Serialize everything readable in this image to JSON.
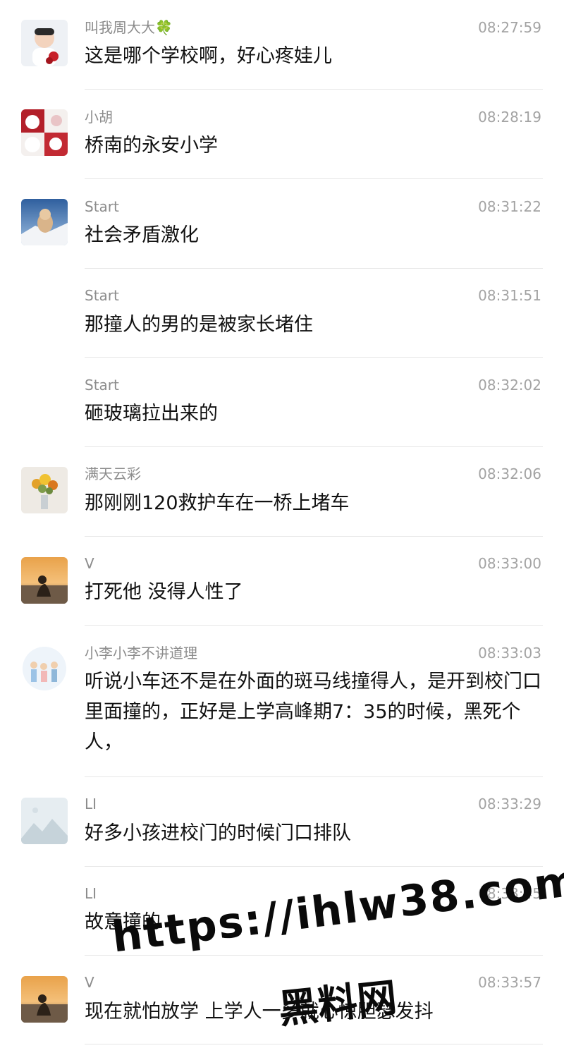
{
  "messages": [
    {
      "name": "叫我周大大🍀",
      "time": "08:27:59",
      "text": "这是哪个学校啊，好心疼娃儿",
      "avatar": "boy-photo-avatar"
    },
    {
      "name": "小胡",
      "time": "08:28:19",
      "text": "桥南的永安小学",
      "avatar": "pig-collage-avatar"
    },
    {
      "name": "Start",
      "time": "08:31:22",
      "text": "社会矛盾激化",
      "avatar": "dog-in-snow-avatar"
    },
    {
      "name": "Start",
      "time": "08:31:51",
      "text": "那撞人的男的是被家长堵住",
      "avatar": ""
    },
    {
      "name": "Start",
      "time": "08:32:02",
      "text": "砸玻璃拉出来的",
      "avatar": ""
    },
    {
      "name": "满天云彩",
      "time": "08:32:06",
      "text": "那刚刚120救护车在一桥上堵车",
      "avatar": "flower-bouquet-avatar"
    },
    {
      "name": "V",
      "time": "08:33:00",
      "text": "打死他 没得人性了",
      "avatar": "sunset-silhouette-avatar"
    },
    {
      "name": "小李小李不讲道理",
      "time": "08:33:03",
      "text": "听说小车还不是在外面的斑马线撞得人，是开到校门口里面撞的，正好是上学高峰期7：35的时候，黑死个人，",
      "avatar": "family-illustration-avatar"
    },
    {
      "name": "LI",
      "time": "08:33:29",
      "text": "好多小孩进校门的时候门口排队",
      "avatar": "mountain-placeholder-avatar"
    },
    {
      "name": "LI",
      "time": "08:33:45",
      "text": "故意撞的",
      "avatar": ""
    },
    {
      "name": "V",
      "time": "08:33:57",
      "text": "现在就怕放学 上学人一多就心惊胆瑟发抖",
      "avatar": "sunset-silhouette-avatar"
    }
  ],
  "watermark": {
    "line1": "https://ihlw38.com",
    "line2": "黑料网"
  }
}
